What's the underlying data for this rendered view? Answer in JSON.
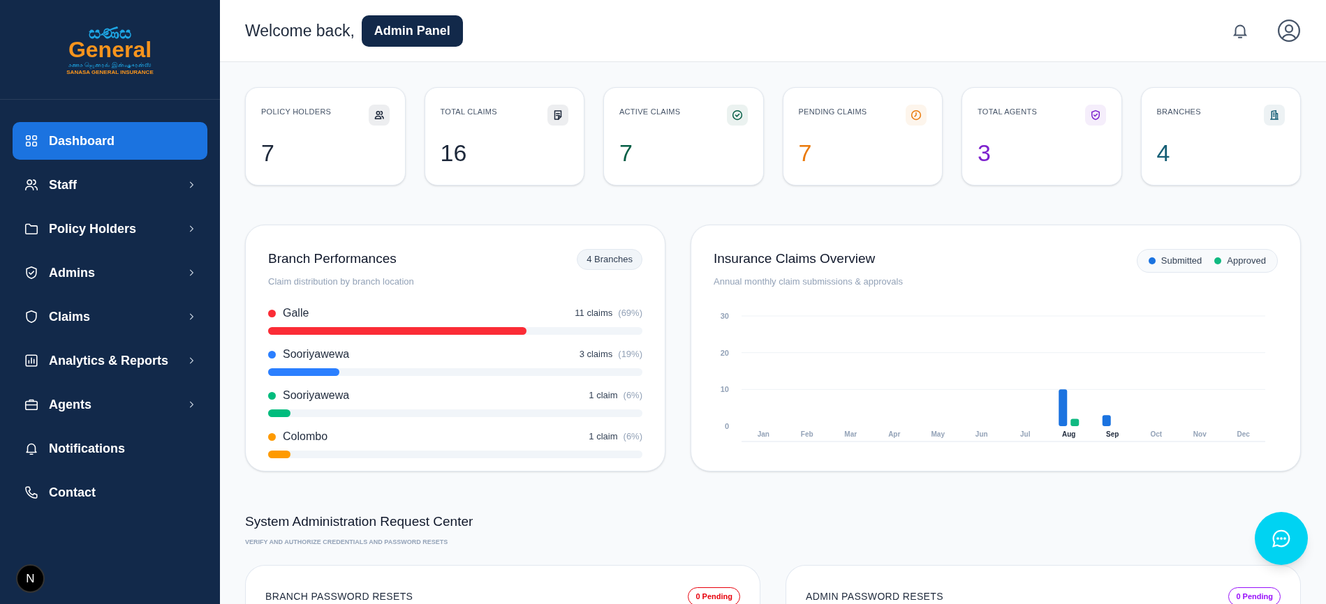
{
  "logo": {
    "script_sinhala": "සණස",
    "name": "General",
    "script_tamil": "சணச ஜெனரல் இன்ஷுரன்ஸ்",
    "tagline": "SANASA GENERAL INSURANCE"
  },
  "sidebar": {
    "items": [
      {
        "label": "Dashboard",
        "kind": "grid",
        "selected": true,
        "expandable": false
      },
      {
        "label": "Staff",
        "kind": "users",
        "selected": false,
        "expandable": true
      },
      {
        "label": "Policy Holders",
        "kind": "folder",
        "selected": false,
        "expandable": true
      },
      {
        "label": "Admins",
        "kind": "shield-check",
        "selected": false,
        "expandable": true
      },
      {
        "label": "Claims",
        "kind": "shield",
        "selected": false,
        "expandable": true
      },
      {
        "label": "Analytics & Reports",
        "kind": "chart",
        "selected": false,
        "expandable": true
      },
      {
        "label": "Agents",
        "kind": "briefcase",
        "selected": false,
        "expandable": true
      },
      {
        "label": "Notifications",
        "kind": "bell",
        "selected": false,
        "expandable": false
      },
      {
        "label": "Contact",
        "kind": "phone",
        "selected": false,
        "expandable": false
      }
    ],
    "dev_badge": "N"
  },
  "header": {
    "greeting": "Welcome back,",
    "role_badge": "Admin Panel"
  },
  "stats": [
    {
      "label": "POLICY HOLDERS",
      "value": "7",
      "kind": "users",
      "color": "#1e293b"
    },
    {
      "label": "TOTAL CLAIMS",
      "value": "16",
      "kind": "note",
      "color": "#1e293b"
    },
    {
      "label": "ACTIVE CLAIMS",
      "value": "7",
      "kind": "check",
      "color": "#065f46"
    },
    {
      "label": "PENDING CLAIMS",
      "value": "7",
      "kind": "clock",
      "color": "#ea7a0c"
    },
    {
      "label": "TOTAL AGENTS",
      "value": "3",
      "kind": "shield",
      "color": "#7e22ce"
    },
    {
      "label": "BRANCHES",
      "value": "4",
      "kind": "building",
      "color": "#155e75"
    }
  ],
  "branch_performance": {
    "title": "Branch Performances",
    "subtitle": "Claim distribution by branch location",
    "badge": "4 Branches",
    "branches": [
      {
        "name": "Galle",
        "claims": "11 claims",
        "share": "(69%)",
        "level": 0.69,
        "color": "#fb2c36"
      },
      {
        "name": "Sooriyawewa",
        "claims": "3 claims",
        "share": "(19%)",
        "level": 0.19,
        "color": "#2b7fff"
      },
      {
        "name": "Sooriyawewa",
        "claims": "1 claim",
        "share": "(6%)",
        "level": 0.06,
        "color": "#00bc7d"
      },
      {
        "name": "Colombo",
        "claims": "1 claim",
        "share": "(6%)",
        "level": 0.06,
        "color": "#fe9a00"
      }
    ]
  },
  "claims_overview": {
    "title": "Insurance Claims Overview",
    "subtitle": "Annual monthly claim submissions & approvals",
    "chart_data": {
      "type": "bar",
      "categories": [
        "Jan",
        "Feb",
        "Mar",
        "Apr",
        "May",
        "Jun",
        "Jul",
        "Aug",
        "Sep",
        "Oct",
        "Nov",
        "Dec"
      ],
      "series": [
        {
          "name": "Submitted",
          "color": "#1b73e0",
          "values": [
            0,
            0,
            0,
            0,
            0,
            0,
            0,
            10,
            3,
            0,
            0,
            0
          ]
        },
        {
          "name": "Approved",
          "color": "#10b981",
          "values": [
            0,
            0,
            0,
            0,
            0,
            0,
            0,
            2,
            0,
            0,
            0,
            0
          ]
        }
      ],
      "ylim": [
        0,
        30
      ],
      "yticks": [
        0,
        10,
        20,
        30
      ]
    }
  },
  "request_center": {
    "title": "System Administration Request Center",
    "subtitle": "VERIFY AND AUTHORIZE CREDENTIALS AND PASSWORD RESETS",
    "panels": [
      {
        "title": "BRANCH PASSWORD RESETS",
        "badge": "0 Pending",
        "color": "#e7000b"
      },
      {
        "title": "ADMIN PASSWORD RESETS",
        "badge": "0 Pending",
        "color": "#9810fa"
      }
    ]
  }
}
